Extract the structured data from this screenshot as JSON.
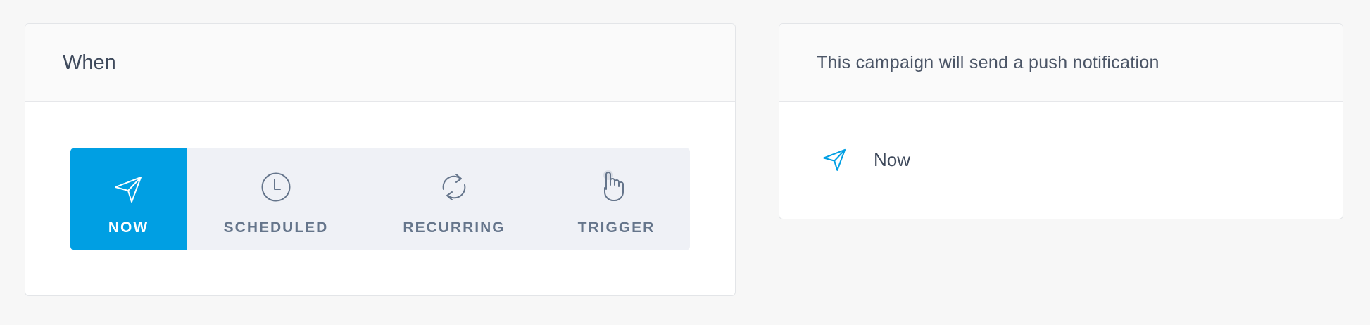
{
  "when_panel": {
    "title": "When",
    "options": [
      {
        "label": "NOW",
        "icon": "paper-plane-icon",
        "selected": true
      },
      {
        "label": "SCHEDULED",
        "icon": "clock-icon",
        "selected": false
      },
      {
        "label": "RECURRING",
        "icon": "refresh-icon",
        "selected": false
      },
      {
        "label": "TRIGGER",
        "icon": "pointer-hand-icon",
        "selected": false
      }
    ]
  },
  "summary_panel": {
    "title": "This campaign will send a push notification",
    "schedule_icon": "paper-plane-icon",
    "schedule_value": "Now"
  },
  "colors": {
    "accent": "#009fe3",
    "option_bg": "#eff1f6",
    "label": "#65758b",
    "text": "#3f4a5c"
  }
}
